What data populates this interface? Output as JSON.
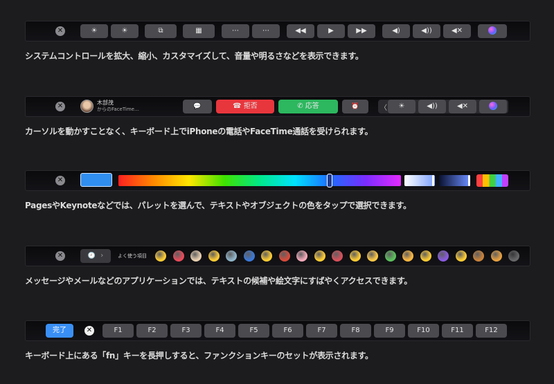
{
  "sections": [
    {
      "caption": "システムコントロールを拡大、縮小、カスタマイズして、音量や明るさなどを表示できます。",
      "close_glyph": "✕",
      "keys": [
        "☀",
        "☀",
        "⧉",
        "▦",
        "⋯",
        "⋯",
        "◀◀",
        "▶",
        "▶▶",
        "◀)",
        "◀))",
        "◀✕",
        ""
      ]
    },
    {
      "caption": "カーソルを動かすことなく、キーボード上でiPhoneの電話やFaceTime通話を受けられます。",
      "close_glyph": "✕",
      "caller_name": "木部茂",
      "caller_sub": "からのFaceTime…",
      "message_glyph": "💬",
      "decline_label": "拒否",
      "accept_label": "応答",
      "alarm_glyph": "⏰",
      "collapse_glyph": "〈",
      "controls": [
        "☀",
        "◀))",
        "◀✕",
        ""
      ],
      "decline_color": "#e8363d",
      "accept_color": "#2db75f"
    },
    {
      "caption": "PagesやKeynoteなどでは、パレットを選んで、テキストやオブジェクトの色をタップで選択できます。",
      "close_glyph": "✕",
      "selected_color": "#2f8ef0"
    },
    {
      "caption": "メッセージやメールなどのアプリケーションでは、テキストの候補や絵文字にすばやくアクセスできます。",
      "close_glyph": "✕",
      "recent_glyph": "🕘",
      "recent_chevron": "›",
      "frequent_label": "よく使う項目",
      "emoji_icons": [
        "smile",
        "heart",
        "grandma",
        "tongue",
        "robot",
        "car",
        "hug",
        "gift",
        "pig",
        "upside",
        "octopus",
        "cool",
        "thumbs",
        "frog",
        "heart-eyes-cat",
        "wink",
        "alien",
        "kiss",
        "burger",
        "pizza",
        "rabbit"
      ]
    },
    {
      "caption": "キーボード上にある「fn」キーを長押しすると、ファンクションキーのセットが表示されます。",
      "done_label": "完了",
      "close_glyph": "✕",
      "fkeys": [
        "F1",
        "F2",
        "F3",
        "F4",
        "F5",
        "F6",
        "F7",
        "F8",
        "F9",
        "F10",
        "F11",
        "F12"
      ],
      "done_color": "#3a8ff5"
    }
  ]
}
